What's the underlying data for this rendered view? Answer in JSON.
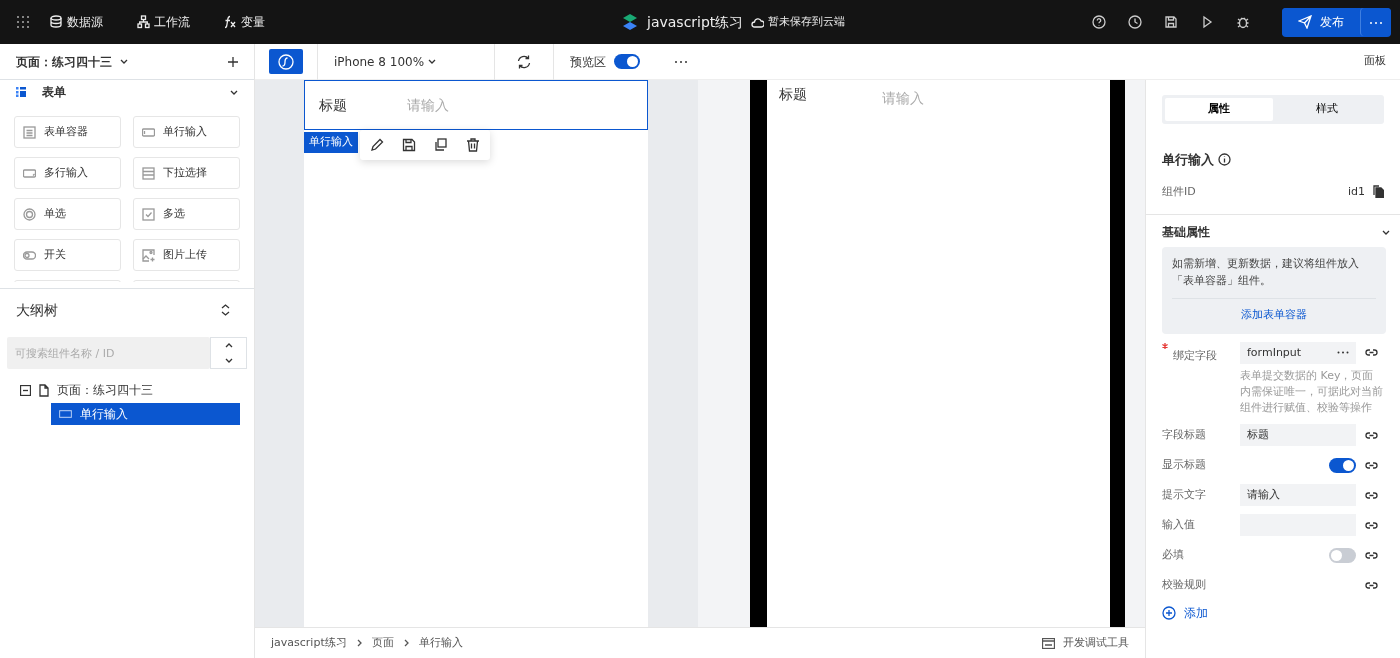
{
  "topbar": {
    "nav_items": [
      {
        "label": "数据源"
      },
      {
        "label": "工作流"
      },
      {
        "label": "变量"
      }
    ],
    "app_title": "javascript练习",
    "save_status": "暂未保存到云端",
    "publish_button": "发布"
  },
  "left_panel": {
    "page_selector": "页面：练习四十三",
    "group": {
      "title": "表单",
      "expanded": true
    },
    "components": [
      {
        "label": "表单容器"
      },
      {
        "label": "单行输入"
      },
      {
        "label": "多行输入"
      },
      {
        "label": "下拉选择"
      },
      {
        "label": "单选"
      },
      {
        "label": "多选"
      },
      {
        "label": "开关"
      },
      {
        "label": "图片上传"
      }
    ],
    "outline": {
      "title": "大纲树",
      "search_placeholder": "可搜索组件名称 / ID",
      "tree": [
        {
          "label": "页面：练习四十三",
          "expanded": true,
          "children": [
            {
              "label": "单行输入",
              "selected": true
            }
          ]
        }
      ]
    }
  },
  "toolbar": {
    "device": "iPhone 8 100%",
    "preview": {
      "label": "预览区",
      "on": true
    },
    "panel_label": "面板"
  },
  "canvas": {
    "field": {
      "label": "标题",
      "placeholder": "请输入"
    },
    "selection_tag": "单行输入"
  },
  "preview": {
    "field": {
      "label": "标题",
      "placeholder": "请输入"
    }
  },
  "breadcrumb": [
    "javascript练习",
    "页面",
    "单行输入"
  ],
  "devtools": "开发调试工具",
  "right_panel": {
    "tabs": [
      {
        "label": "属性",
        "selected": true
      },
      {
        "label": "样式",
        "selected": false
      }
    ],
    "component_title": "单行输入",
    "id_label": "组件ID",
    "id_value": "id1",
    "section": {
      "title": "基础属性",
      "expanded": true
    },
    "notice": "如需新增、更新数据，建议将组件放入「表单容器」组件。",
    "notice_link": "添加表单容器",
    "properties": [
      {
        "kind": "bind",
        "label": "绑定字段",
        "required": true,
        "value": "formInput",
        "help": "表单提交数据的 Key，页面内需保证唯一，可据此对当前组件进行赋值、校验等操作"
      },
      {
        "kind": "field",
        "label": "字段标题",
        "required": false,
        "value": "标题"
      },
      {
        "kind": "switch",
        "label": "显示标题",
        "required": false,
        "on": true
      },
      {
        "kind": "field",
        "label": "提示文字",
        "required": false,
        "value": "请输入"
      },
      {
        "kind": "field",
        "label": "输入值",
        "required": false
      },
      {
        "kind": "switch",
        "label": "必填",
        "required": false,
        "on": false
      },
      {
        "kind": "rule",
        "label": "校验规则",
        "required": false
      }
    ],
    "add_label": "添加"
  }
}
